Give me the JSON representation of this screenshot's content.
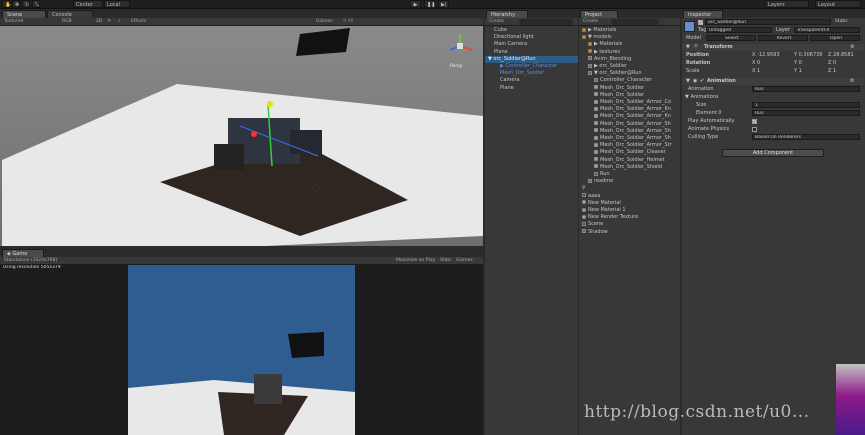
{
  "toolbar": {
    "tabs": [
      "Scene",
      "Console"
    ],
    "center": "Center",
    "local": "Local",
    "layers": "Layers",
    "layout": "Layout"
  },
  "scene_view": {
    "shading": "Textured",
    "mode": "RGB",
    "toggle_2d": "2D",
    "effects": "Effects",
    "gizmos": "Gizmos",
    "persp": "Persp"
  },
  "game_view": {
    "tab": "Game",
    "resolution": "Standalone (1024x768)",
    "maximize": "Maximize on Play",
    "stats": "Stats",
    "gizmos": "Gizmos",
    "using_resolution": "Using resolution 505x379"
  },
  "hierarchy": {
    "tab": "Hierarchy",
    "create": "Create",
    "items": [
      {
        "label": "Cube",
        "indent": 1,
        "style": "normal"
      },
      {
        "label": "Directional light",
        "indent": 1,
        "style": "normal"
      },
      {
        "label": "Main Camera",
        "indent": 1,
        "style": "normal"
      },
      {
        "label": "Plane",
        "indent": 1,
        "style": "normal"
      },
      {
        "label": "▼ orc_Soldier@Run",
        "indent": 0,
        "style": "selected"
      },
      {
        "label": "▶ Controller_Character",
        "indent": 2,
        "style": "blue"
      },
      {
        "label": "Mesh_Orc_Soldier",
        "indent": 2,
        "style": "blue"
      },
      {
        "label": "Camera",
        "indent": 2,
        "style": "normal"
      },
      {
        "label": "Plane",
        "indent": 2,
        "style": "normal"
      }
    ]
  },
  "project": {
    "tab": "Project",
    "create": "Create",
    "items": [
      {
        "label": "▶ Materials",
        "indent": 0,
        "icon": "folder"
      },
      {
        "label": "▼ models",
        "indent": 0,
        "icon": "folder"
      },
      {
        "label": "▶ Materials",
        "indent": 1,
        "icon": "folder"
      },
      {
        "label": "▶ textures",
        "indent": 1,
        "icon": "folder"
      },
      {
        "label": "Anim_Blending",
        "indent": 1,
        "icon": "file"
      },
      {
        "label": "▶ orc_Soldier",
        "indent": 1,
        "icon": "model"
      },
      {
        "label": "▼ orc_Soldier@Run",
        "indent": 1,
        "icon": "model"
      },
      {
        "label": "Controller_Character",
        "indent": 2,
        "icon": "file"
      },
      {
        "label": "Mesh_Orc_Soldier",
        "indent": 2,
        "icon": "mesh"
      },
      {
        "label": "Mesh_Orc_Soldier",
        "indent": 2,
        "icon": "mesh"
      },
      {
        "label": "Mesh_Orc_Soldier_Armor_Co",
        "indent": 2,
        "icon": "mesh"
      },
      {
        "label": "Mesh_Orc_Soldier_Armor_Kn",
        "indent": 2,
        "icon": "mesh"
      },
      {
        "label": "Mesh_Orc_Soldier_Armor_Kn",
        "indent": 2,
        "icon": "mesh"
      },
      {
        "label": "Mesh_Orc_Soldier_Armor_Sh",
        "indent": 2,
        "icon": "mesh"
      },
      {
        "label": "Mesh_Orc_Soldier_Armor_Sh",
        "indent": 2,
        "icon": "mesh"
      },
      {
        "label": "Mesh_Orc_Soldier_Armor_Sh",
        "indent": 2,
        "icon": "mesh"
      },
      {
        "label": "Mesh_Orc_Soldier_Armor_Str",
        "indent": 2,
        "icon": "mesh"
      },
      {
        "label": "Mesh_Orc_Soldier_Cleaver",
        "indent": 2,
        "icon": "mesh"
      },
      {
        "label": "Mesh_Orc_Soldier_Helmet",
        "indent": 2,
        "icon": "mesh"
      },
      {
        "label": "Mesh_Orc_Soldier_Shield",
        "indent": 2,
        "icon": "mesh"
      },
      {
        "label": "Run",
        "indent": 2,
        "icon": "anim"
      },
      {
        "label": "readme",
        "indent": 1,
        "icon": "file"
      },
      {
        "label": "⚲",
        "indent": 0,
        "icon": "none"
      },
      {
        "label": "aaaa",
        "indent": 0,
        "icon": "scene"
      },
      {
        "label": "New Material",
        "indent": 0,
        "icon": "mat"
      },
      {
        "label": "New Material 1",
        "indent": 0,
        "icon": "mat"
      },
      {
        "label": "New Render Texture",
        "indent": 0,
        "icon": "mat"
      },
      {
        "label": "Scene",
        "indent": 0,
        "icon": "scene"
      },
      {
        "label": "Shadow",
        "indent": 0,
        "icon": "file"
      }
    ]
  },
  "inspector": {
    "tab": "Inspector",
    "object_name": "orc_Soldier@Run",
    "static": "Static",
    "tag_label": "Tag",
    "tag_value": "Untagged",
    "layer_label": "Layer",
    "layer_value": "TransparentFX",
    "model_label": "Model",
    "select": "Select",
    "revert": "Revert",
    "open": "Open",
    "transform": {
      "title": "Transform",
      "position_label": "Position",
      "rotation_label": "Rotation",
      "scale_label": "Scale",
      "px": "X -12.9593",
      "py": "Y 0.306736",
      "pz": "Z 28.8581",
      "rx": "X 0",
      "ry": "Y 0",
      "rz": "Z 0",
      "sx": "X 1",
      "sy": "Y 1",
      "sz": "Z 1"
    },
    "animation": {
      "title": "Animation",
      "anim_label": "Animation",
      "anim_value": "Run",
      "animations_label": "Animations",
      "size_label": "Size",
      "size_value": "1",
      "element0_label": "Element 0",
      "element0_value": "Run",
      "play_auto": "Play Automatically",
      "animate_physics": "Animate Physics",
      "culling_label": "Culling Type",
      "culling_value": "Based On Renderers"
    },
    "add_component": "Add Component"
  },
  "watermark": "http://blog.csdn.net/u0...",
  "colors": {
    "scene_bg": "#7a7a7a",
    "plane_light": "#e6e6e6",
    "plane_dark": "#2f2621",
    "game_sky": "#2f5d8f",
    "selection": "#2c5d87"
  }
}
